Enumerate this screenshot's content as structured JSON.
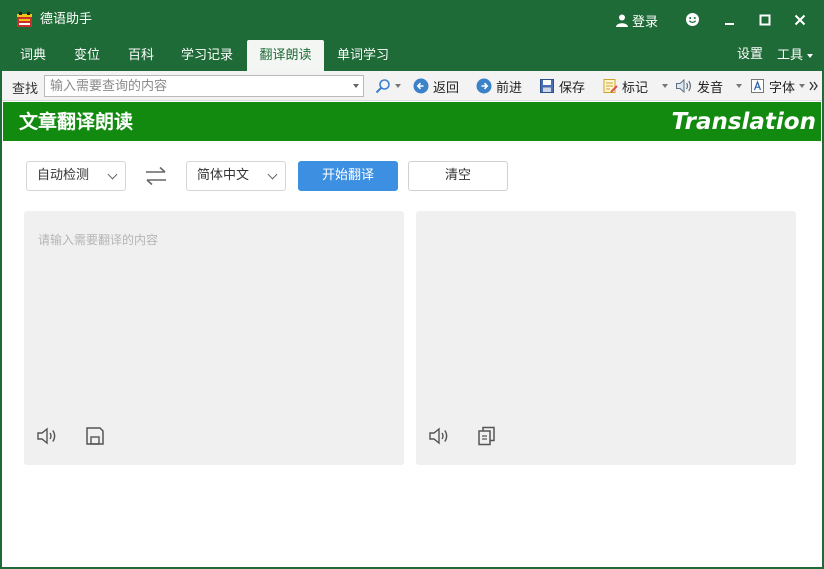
{
  "app": {
    "title": "德语助手"
  },
  "titlebar": {
    "login_label": "登录"
  },
  "menu": {
    "tabs": [
      {
        "label": "词典"
      },
      {
        "label": "变位"
      },
      {
        "label": "百科"
      },
      {
        "label": "学习记录"
      },
      {
        "label": "翻译朗读"
      },
      {
        "label": "单词学习"
      }
    ],
    "active_tab": "翻译朗读",
    "settings_label": "设置",
    "tools_label": "工具"
  },
  "toolbar": {
    "search_label": "查找",
    "search_placeholder": "输入需要查询的内容",
    "back_label": "返回",
    "forward_label": "前进",
    "save_label": "保存",
    "mark_label": "标记",
    "pronounce_label": "发音",
    "font_label": "字体"
  },
  "banner": {
    "title": "文章翻译朗读",
    "subtitle": "Translation"
  },
  "translate": {
    "source_lang": "自动检测",
    "target_lang": "简体中文",
    "start_button": "开始翻译",
    "clear_button": "清空",
    "input_placeholder": "请输入需要翻译的内容"
  },
  "colors": {
    "titlebar": "#1e6b37",
    "banner": "#118a0f",
    "primary_button": "#3d8fe1",
    "panel": "#f0f0f0"
  }
}
